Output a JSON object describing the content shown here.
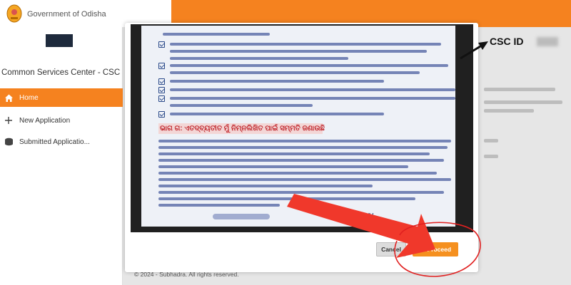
{
  "header": {
    "title": "Government of Odisha"
  },
  "sidebar": {
    "title": "Common Services Center - CSC",
    "items": [
      {
        "label": "Home",
        "icon": "home-icon",
        "active": true
      },
      {
        "label": "New Application",
        "icon": "plus-icon",
        "active": false
      },
      {
        "label": "Submitted Applicatio...",
        "icon": "database-icon",
        "active": false
      }
    ]
  },
  "document": {
    "section_heading": "ଭାଗ ଗ: ଏତଦ୍‌ବ୍ୟତୀତ ମୁଁ ନିମ୍ନଲିଖିତ ପାଇଁ ସମ୍ମତି ଜଣାଉଛି",
    "year": "/2024"
  },
  "modal": {
    "cancel_label": "Cancel",
    "proceed_label": "Proceed"
  },
  "annotation": {
    "csc_label": "CSC ID"
  },
  "footer": {
    "text": "© 2024 - Subhadra. All rights reserved."
  },
  "colors": {
    "brand_orange": "#f5821f",
    "proceed_orange": "#f5901f",
    "arrow_red": "#f0382b",
    "dark_navy": "#1e2a3c"
  }
}
